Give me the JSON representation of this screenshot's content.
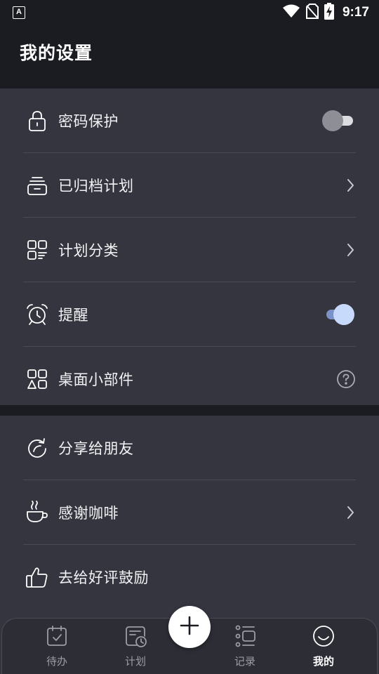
{
  "status_bar": {
    "app_icon": "A",
    "time": "9:17",
    "icons": [
      "wifi-icon",
      "no-sim-icon",
      "battery-charging-icon"
    ]
  },
  "header": {
    "title": "我的设置"
  },
  "settings_group_1": [
    {
      "id": "password",
      "label": "密码保护",
      "icon": "lock-icon",
      "trailing": "toggle",
      "enabled": false
    },
    {
      "id": "archived",
      "label": "已归档计划",
      "icon": "archive-box-icon",
      "trailing": "chevron"
    },
    {
      "id": "category",
      "label": "计划分类",
      "icon": "category-grid-icon",
      "trailing": "chevron"
    },
    {
      "id": "reminder",
      "label": "提醒",
      "icon": "alarm-clock-icon",
      "trailing": "toggle",
      "enabled": true
    },
    {
      "id": "widget",
      "label": "桌面小部件",
      "icon": "widget-shapes-icon",
      "trailing": "help"
    }
  ],
  "settings_group_2": [
    {
      "id": "share",
      "label": "分享给朋友",
      "icon": "share-arrow-icon",
      "trailing": "none"
    },
    {
      "id": "coffee",
      "label": "感谢咖啡",
      "icon": "coffee-cup-icon",
      "trailing": "chevron"
    },
    {
      "id": "rate",
      "label": "去给好评鼓励",
      "icon": "thumbs-up-icon",
      "trailing": "none"
    }
  ],
  "bottom_nav": {
    "items": [
      {
        "id": "todo",
        "label": "待办",
        "icon": "calendar-check-icon",
        "active": false
      },
      {
        "id": "plan",
        "label": "计划",
        "icon": "plan-clock-icon",
        "active": false
      },
      {
        "id": "record",
        "label": "记录",
        "icon": "record-list-icon",
        "active": false
      },
      {
        "id": "mine",
        "label": "我的",
        "icon": "smile-face-icon",
        "active": true
      }
    ],
    "fab_icon": "plus-icon"
  },
  "colors": {
    "background": "#1b1c22",
    "card": "#34353f",
    "divider": "#4a4b56",
    "toggle_on_thumb": "#c8dafb",
    "toggle_on_track": "#7a93c7",
    "toggle_off_thumb": "#8e8f96",
    "nav_inactive": "#9c9da6",
    "nav_active": "#ffffff"
  }
}
